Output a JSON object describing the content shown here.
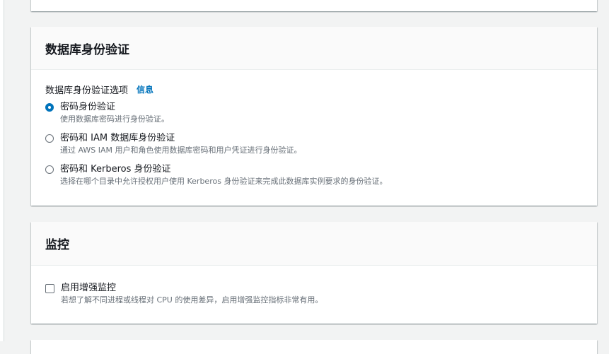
{
  "auth_panel": {
    "title": "数据库身份验证",
    "field_label": "数据库身份验证选项",
    "info_link": "信息",
    "options": [
      {
        "label": "密码身份验证",
        "description": "使用数据库密码进行身份验证。",
        "selected": true
      },
      {
        "label": "密码和 IAM 数据库身份验证",
        "description": "通过 AWS IAM 用户和角色使用数据库密码和用户凭证进行身份验证。",
        "selected": false
      },
      {
        "label": "密码和 Kerberos 身份验证",
        "description": "选择在哪个目录中允许授权用户使用 Kerberos 身份验证来完成此数据库实例要求的身份验证。",
        "selected": false
      }
    ]
  },
  "monitor_panel": {
    "title": "监控",
    "checkbox_label": "启用增强监控",
    "checkbox_description": "若想了解不同进程或线程对 CPU 的使用差异，启用增强监控指标非常有用。",
    "checked": false
  },
  "colors": {
    "accent": "#0073bb",
    "background": "#f2f3f3",
    "secondary_text": "#687078"
  }
}
